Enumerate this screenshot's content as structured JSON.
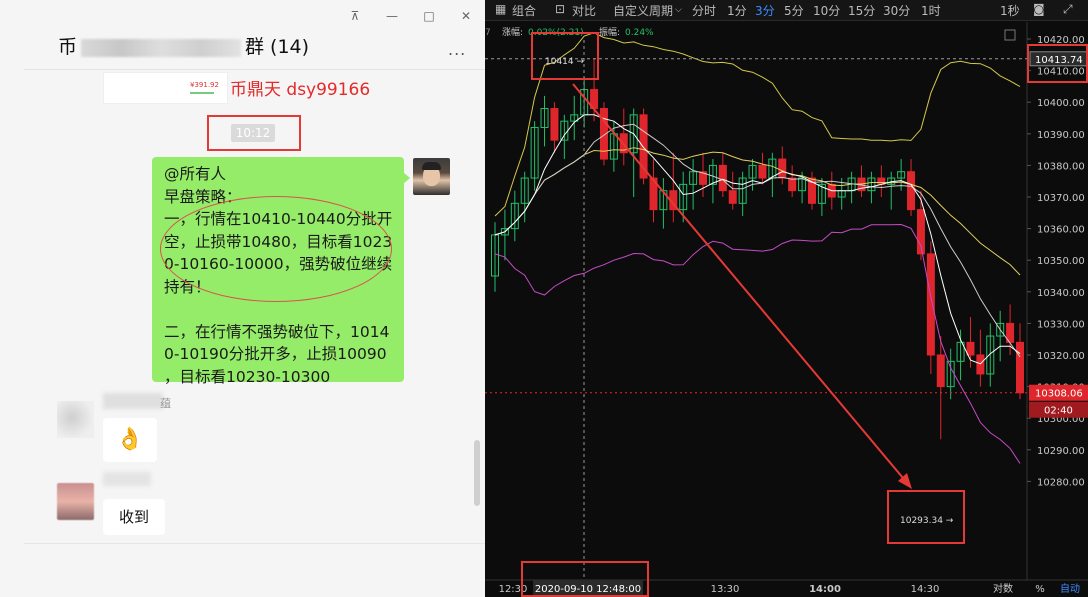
{
  "chat": {
    "title_prefix": "币",
    "title_suffix": "群 (14)",
    "more_label": "...",
    "window_buttons": [
      "⊼",
      "—",
      "□",
      "✕"
    ],
    "price_thumb": "¥391.92",
    "signature": "币鼎天 dsy99166",
    "time": "10:12",
    "bubble_lines": [
      "@所有人",
      "早盘策略：",
      "一，行情在10410-10440分批开",
      "空，止损带10480，目标看1023",
      "0-10160-10000，强势破位继续",
      "持有！",
      "",
      "二，在行情不强势破位下，1014",
      "0-10190分批开多，止损10090",
      "，目标看10230-10300"
    ],
    "name1_tail": "蕴",
    "msg1": "👌",
    "msg2": "收到"
  },
  "chart": {
    "toolbar": {
      "combo": "组合",
      "compare": "对比",
      "custom_period": "自定义周期",
      "periods": [
        "分时",
        "1分",
        "3分",
        "5分",
        "10分",
        "15分",
        "30分",
        "1时"
      ],
      "active_period": "3分",
      "right_label": "1秒"
    },
    "info_bar": {
      "prefix": "7",
      "change_label": "涨幅:",
      "change_value": "0.02%(2.21)",
      "amp_label": "振幅:",
      "amp_value": "0.24%"
    },
    "y_ticks": [
      "10420.00",
      "10410.00",
      "10400.00",
      "10390.00",
      "10380.00",
      "10370.00",
      "10360.00",
      "10350.00",
      "10340.00",
      "10330.00",
      "10320.00",
      "10310.00",
      "10300.00",
      "10290.00",
      "10280.00"
    ],
    "x_ticks": [
      "12:30",
      "13:30",
      "14:00",
      "14:30"
    ],
    "bottom_right": [
      "对数",
      "%",
      "自动"
    ],
    "crosshair_time": "2020-09-10 12:48:00",
    "crosshair_price": "10413.74",
    "high_label": "10414",
    "low_label": "10293.34",
    "current_price": "10308.06",
    "countdown": "02:40",
    "colors": {
      "up": "#22c06a",
      "down": "#e0262d",
      "upper_band": "#d4c84a",
      "lower_band": "#c54cc5",
      "annotation": "#e53935"
    }
  },
  "chart_data": {
    "type": "candlestick",
    "interval": "3分",
    "ylim": [
      10280,
      10420
    ],
    "x_ticks": [
      "12:30",
      "13:30",
      "14:00",
      "14:30"
    ],
    "candles": [
      [
        10345,
        10362,
        10340,
        10358
      ],
      [
        10358,
        10366,
        10350,
        10360
      ],
      [
        10360,
        10372,
        10356,
        10368
      ],
      [
        10368,
        10378,
        10362,
        10376
      ],
      [
        10376,
        10394,
        10372,
        10392
      ],
      [
        10392,
        10402,
        10386,
        10398
      ],
      [
        10398,
        10400,
        10384,
        10388
      ],
      [
        10388,
        10396,
        10382,
        10394
      ],
      [
        10394,
        10402,
        10388,
        10396
      ],
      [
        10396,
        10408,
        10392,
        10404
      ],
      [
        10404,
        10414,
        10394,
        10398
      ],
      [
        10398,
        10400,
        10380,
        10382
      ],
      [
        10382,
        10394,
        10378,
        10390
      ],
      [
        10390,
        10398,
        10380,
        10384
      ],
      [
        10384,
        10398,
        10370,
        10396
      ],
      [
        10396,
        10398,
        10374,
        10376
      ],
      [
        10376,
        10382,
        10362,
        10366
      ],
      [
        10366,
        10376,
        10360,
        10372
      ],
      [
        10372,
        10384,
        10362,
        10366
      ],
      [
        10366,
        10378,
        10362,
        10374
      ],
      [
        10374,
        10382,
        10366,
        10378
      ],
      [
        10378,
        10384,
        10370,
        10374
      ],
      [
        10374,
        10382,
        10368,
        10380
      ],
      [
        10380,
        10384,
        10370,
        10372
      ],
      [
        10372,
        10378,
        10366,
        10368
      ],
      [
        10368,
        10378,
        10364,
        10376
      ],
      [
        10376,
        10382,
        10372,
        10380
      ],
      [
        10380,
        10384,
        10374,
        10376
      ],
      [
        10376,
        10384,
        10370,
        10382
      ],
      [
        10382,
        10386,
        10374,
        10376
      ],
      [
        10376,
        10380,
        10370,
        10372
      ],
      [
        10372,
        10378,
        10368,
        10376
      ],
      [
        10376,
        10378,
        10366,
        10368
      ],
      [
        10368,
        10376,
        10364,
        10374
      ],
      [
        10374,
        10378,
        10366,
        10370
      ],
      [
        10370,
        10376,
        10366,
        10372
      ],
      [
        10372,
        10378,
        10368,
        10376
      ],
      [
        10376,
        10380,
        10370,
        10372
      ],
      [
        10372,
        10378,
        10368,
        10376
      ],
      [
        10376,
        10380,
        10370,
        10374
      ],
      [
        10374,
        10378,
        10366,
        10376
      ],
      [
        10376,
        10382,
        10372,
        10378
      ],
      [
        10378,
        10382,
        10364,
        10366
      ],
      [
        10366,
        10372,
        10350,
        10352
      ],
      [
        10352,
        10356,
        10314,
        10320
      ],
      [
        10320,
        10326,
        10293.34,
        10310
      ],
      [
        10310,
        10322,
        10306,
        10318
      ],
      [
        10318,
        10328,
        10312,
        10324
      ],
      [
        10324,
        10332,
        10316,
        10320
      ],
      [
        10320,
        10328,
        10310,
        10314
      ],
      [
        10314,
        10330,
        10310,
        10326
      ],
      [
        10326,
        10334,
        10318,
        10330
      ],
      [
        10330,
        10336,
        10320,
        10324
      ],
      [
        10324,
        10330,
        10306,
        10308.06
      ]
    ]
  }
}
